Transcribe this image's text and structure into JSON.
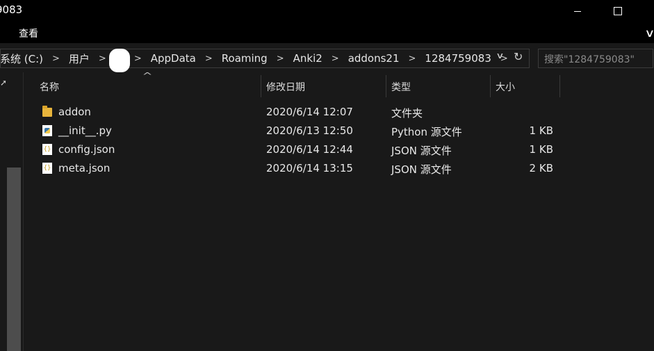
{
  "window": {
    "title": "9083",
    "min_label": "—",
    "max_label": "☐"
  },
  "ribbon": {
    "view_tab": "查看",
    "expand_icon": "chevron-down-icon"
  },
  "address": {
    "crumbs": [
      "系统 (C:)",
      "用户",
      "",
      "AppData",
      "Roaming",
      "Anki2",
      "addons21",
      "1284759083"
    ],
    "refresh_icon": "↻",
    "dropdown_icon": "∨"
  },
  "search": {
    "placeholder": "搜索\"1284759083\""
  },
  "columns": {
    "name": "名称",
    "date": "修改日期",
    "type": "类型",
    "size": "大小"
  },
  "files": [
    {
      "name": "addon",
      "date": "2020/6/14 12:07",
      "type": "文件夹",
      "size": "",
      "icon": "folder-icon"
    },
    {
      "name": "__init__.py",
      "date": "2020/6/13 12:50",
      "type": "Python 源文件",
      "size": "1 KB",
      "icon": "python-file-icon"
    },
    {
      "name": "config.json",
      "date": "2020/6/14 12:44",
      "type": "JSON 源文件",
      "size": "1 KB",
      "icon": "json-file-icon"
    },
    {
      "name": "meta.json",
      "date": "2020/6/14 13:15",
      "type": "JSON 源文件",
      "size": "2 KB",
      "icon": "json-file-icon"
    }
  ],
  "colors": {
    "background": "#191919",
    "titlebar": "#000000",
    "folder": "#e8b53c"
  }
}
